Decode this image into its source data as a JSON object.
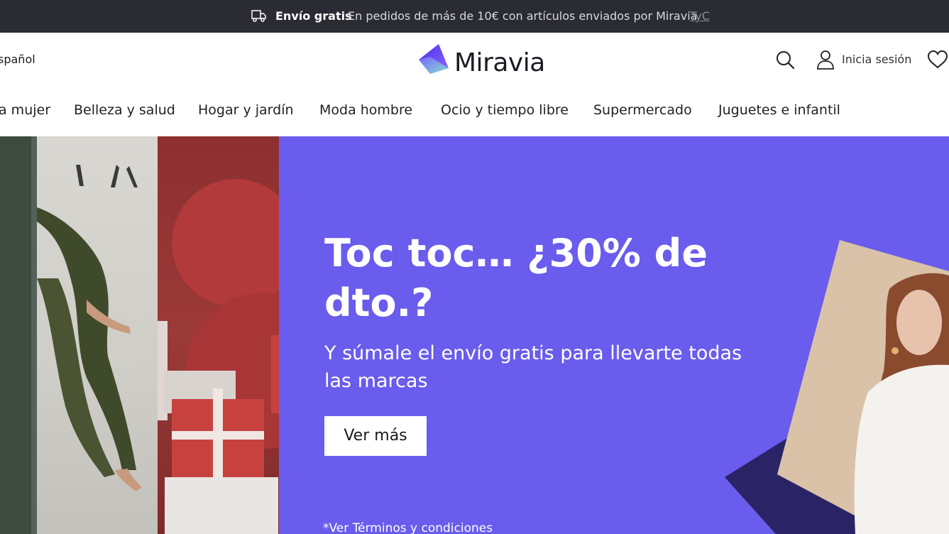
{
  "promo_bar": {
    "bold": "Envío gratis",
    "text": "En pedidos de más de 10€ con artículos enviados por Miravia",
    "link": "TyC"
  },
  "header": {
    "language": "spañol",
    "logo_text": "Miravia",
    "account_label": "Inicia sesión",
    "icons": [
      "search-icon",
      "user-icon",
      "heart-icon",
      "truck-icon"
    ]
  },
  "nav": {
    "items": [
      "a mujer",
      "Belleza y salud",
      "Hogar y jardín",
      "Moda hombre",
      "Ocio y tiempo libre",
      "Supermercado",
      "Juguetes e infantil"
    ]
  },
  "hero": {
    "title": "Toc toc… ¿30% de dto.?",
    "subtitle": "Y súmale el envío gratis para llevarte todas las marcas",
    "cta": "Ver más",
    "terms": "*Ver Términos y condiciones"
  },
  "colors": {
    "promo_bar_bg": "#2b2b33",
    "hero_purple": "#6a5cec",
    "hero_dark": "#2a2466",
    "logo_gradient": [
      "#5b3df0",
      "#8e6bff",
      "#7fe3c6"
    ]
  }
}
